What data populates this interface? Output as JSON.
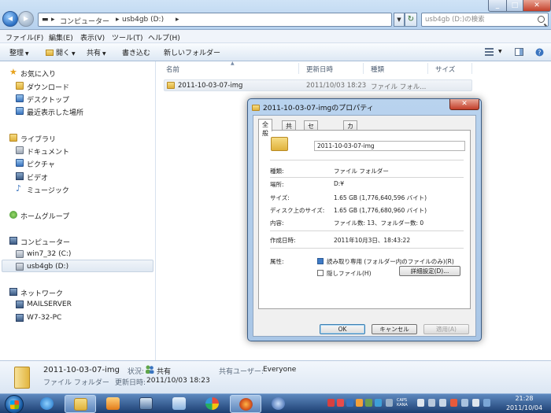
{
  "address": {
    "parts": [
      "コンピューター",
      "usb4gb (D:)"
    ],
    "separator": "▸",
    "search_placeholder": "usb4gb (D:)の検索"
  },
  "menu": [
    "ファイル(F)",
    "編集(E)",
    "表示(V)",
    "ツール(T)",
    "ヘルプ(H)"
  ],
  "toolbar": {
    "organize": "整理",
    "open": "開く",
    "share": "共有",
    "burn": "書き込む",
    "new_folder": "新しいフォルダー"
  },
  "nav": {
    "favorites": "お気に入り",
    "downloads": "ダウンロード",
    "desktop": "デスクトップ",
    "recent": "最近表示した場所",
    "libraries": "ライブラリ",
    "documents": "ドキュメント",
    "pictures": "ピクチャ",
    "videos": "ビデオ",
    "music": "ミュージック",
    "homegroup": "ホームグループ",
    "computer": "コンピューター",
    "drive_c": "win7_32 (C:)",
    "drive_d": "usb4gb (D:)",
    "network": "ネットワーク",
    "net1": "MAILSERVER",
    "net2": "W7-32-PC"
  },
  "columns": {
    "name": "名前",
    "modified": "更新日時",
    "type": "種類",
    "size": "サイズ"
  },
  "files": [
    {
      "name": "2011-10-03-07-img",
      "modified": "2011/10/03 18:23",
      "type": "ファイル フォル..."
    }
  ],
  "details": {
    "name": "2011-10-03-07-img",
    "status_label": "状況:",
    "status_value": "共有",
    "shared_label": "共有ユーザー:",
    "shared_value": "Everyone",
    "type": "ファイル フォルダー",
    "modified_label": "更新日時:",
    "modified_value": "2011/10/03 18:23"
  },
  "dialog": {
    "title": "2011-10-03-07-imgのプロパティ",
    "close": "✕",
    "tabs": [
      "全般",
      "共有",
      "セキュリティ",
      "カスタマイズ"
    ],
    "folder_name": "2011-10-03-07-img",
    "type_label": "種類:",
    "type_value": "ファイル フォルダー",
    "location_label": "場所:",
    "location_value": "D:¥",
    "size_label": "サイズ:",
    "size_value": "1.65 GB (1,776,640,596 バイト)",
    "disk_label": "ディスク上のサイズ:",
    "disk_value": "1.65 GB (1,776,680,960 バイト)",
    "contents_label": "内容:",
    "contents_value": "ファイル数: 13、フォルダー数: 0",
    "created_label": "作成日時:",
    "created_value": "2011年10月3日、18:43:22",
    "attr_label": "属性:",
    "readonly_label": "読み取り専用 (フォルダー内のファイルのみ)(R)",
    "hidden_label": "隠しファイル(H)",
    "advanced": "詳細設定(D)...",
    "ok": "OK",
    "cancel": "キャンセル",
    "apply": "適用(A)"
  },
  "taskbar": {
    "time": "21:28",
    "date": "2011/10/04",
    "ime": "CAPS KANA"
  }
}
